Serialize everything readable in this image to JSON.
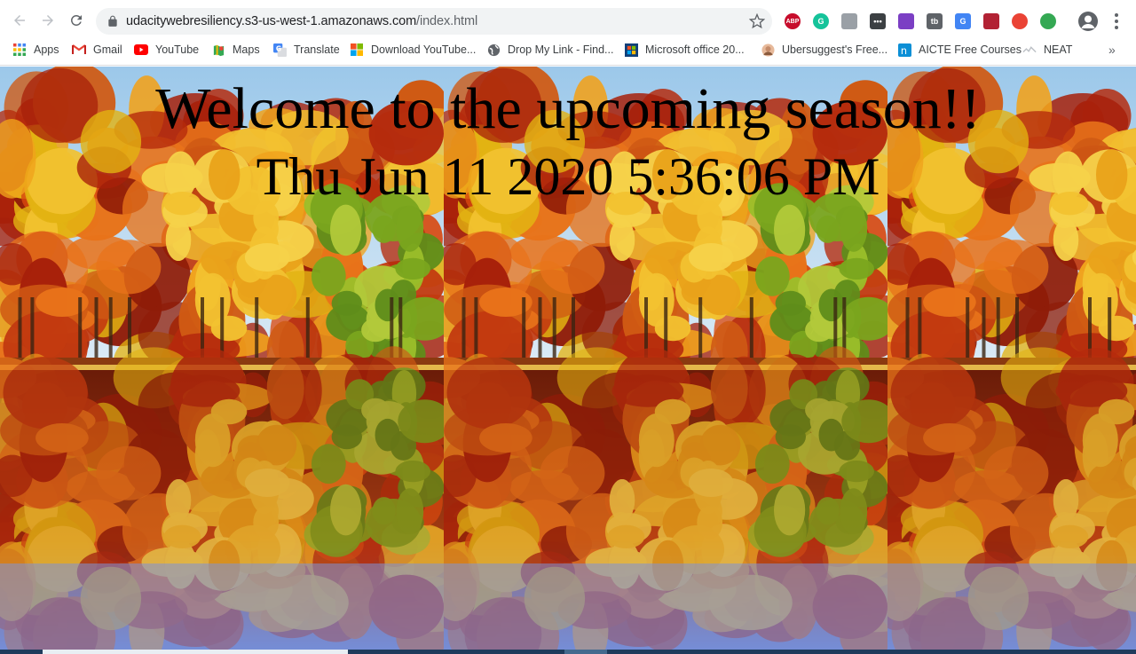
{
  "browser": {
    "url_host": "udacitywebresiliency.s3-us-west-1.amazonaws.com",
    "url_path": "/index.html",
    "nav_icons": [
      "back-icon",
      "forward-icon",
      "reload-icon"
    ],
    "extensions": [
      {
        "name": "adblock-plus-icon",
        "label": "ABP",
        "color": "#c70d2c"
      },
      {
        "name": "grammarly-icon",
        "label": "G",
        "color": "#15c39a"
      },
      {
        "name": "extension-gray-icon",
        "label": "",
        "color": "#9aa0a6"
      },
      {
        "name": "extension-dots-icon",
        "label": "•••",
        "color": "#3c4043"
      },
      {
        "name": "feather-icon",
        "label": "",
        "color": "#7b3fc4"
      },
      {
        "name": "extension-tb-icon",
        "label": "tb",
        "color": "#5f6368"
      },
      {
        "name": "google-translate-icon",
        "label": "G",
        "color": "#4285f4"
      },
      {
        "name": "flag-icon",
        "label": "",
        "color": "#b22234"
      },
      {
        "name": "extension-ring-icon",
        "label": "",
        "color": "#ea4335"
      },
      {
        "name": "extension-globe-icon",
        "label": "",
        "color": "#34a853"
      }
    ]
  },
  "bookmarks": [
    {
      "name": "bookmark-apps",
      "label": "Apps",
      "icon": "apps-grid-icon"
    },
    {
      "name": "bookmark-gmail",
      "label": "Gmail",
      "icon": "gmail-icon"
    },
    {
      "name": "bookmark-youtube",
      "label": "YouTube",
      "icon": "youtube-icon"
    },
    {
      "name": "bookmark-maps",
      "label": "Maps",
      "icon": "maps-icon"
    },
    {
      "name": "bookmark-translate",
      "label": "Translate",
      "icon": "translate-icon"
    },
    {
      "name": "bookmark-download-youtube",
      "label": "Download YouTube...",
      "icon": "microsoft-icon"
    },
    {
      "name": "bookmark-drop-my-link",
      "label": "Drop My Link - Find...",
      "icon": "globe-icon"
    },
    {
      "name": "bookmark-microsoft-office",
      "label": "Microsoft office 20...",
      "icon": "office-icon"
    },
    {
      "name": "bookmark-ubersuggest",
      "label": "Ubersuggest's Free...",
      "icon": "avatar-icon"
    },
    {
      "name": "bookmark-aicte",
      "label": "AICTE Free Courses",
      "icon": "aicte-icon"
    },
    {
      "name": "bookmark-neat",
      "label": "NEAT",
      "icon": "neat-icon"
    }
  ],
  "page": {
    "title": "Welcome to the upcoming season!!",
    "datetime": "Thu Jun 11 2020 5:36:06 PM"
  }
}
